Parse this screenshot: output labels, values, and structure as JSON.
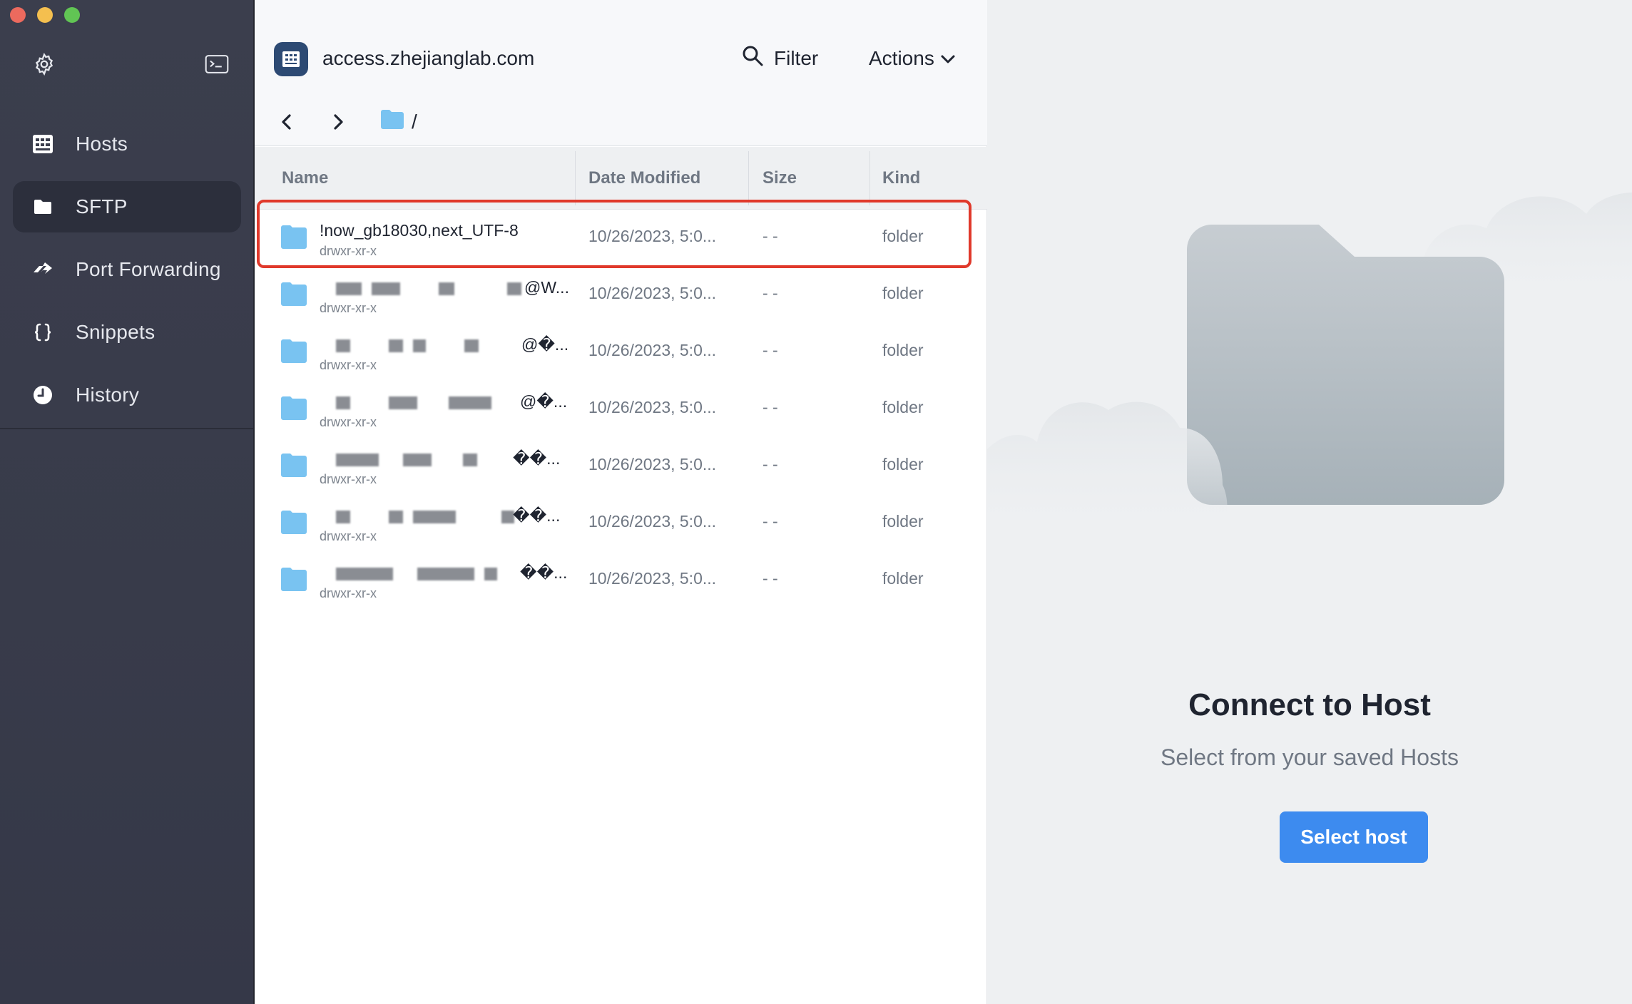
{
  "sidebar": {
    "items": [
      {
        "label": "Hosts",
        "icon": "hosts-icon"
      },
      {
        "label": "SFTP",
        "icon": "folder-icon",
        "active": true
      },
      {
        "label": "Port Forwarding",
        "icon": "port-forward-icon"
      },
      {
        "label": "Snippets",
        "icon": "braces-icon"
      },
      {
        "label": "History",
        "icon": "clock-icon"
      }
    ]
  },
  "header": {
    "host_name": "access.zhejianglab.com",
    "filter_label": "Filter",
    "actions_label": "Actions",
    "path": "/"
  },
  "table": {
    "columns": [
      "Name",
      "Date Modified",
      "Size",
      "Kind"
    ],
    "rows": [
      {
        "name": "!now_gb18030,next_UTF-8",
        "perm": "drwxr-xr-x",
        "date": "10/26/2023, 5:0...",
        "size": "- -",
        "kind": "folder"
      },
      {
        "name": "@W...",
        "perm": "drwxr-xr-x",
        "date": "10/26/2023, 5:0...",
        "size": "- -",
        "kind": "folder"
      },
      {
        "name": "@�...",
        "perm": "drwxr-xr-x",
        "date": "10/26/2023, 5:0...",
        "size": "- -",
        "kind": "folder"
      },
      {
        "name": "@�...",
        "perm": "drwxr-xr-x",
        "date": "10/26/2023, 5:0...",
        "size": "- -",
        "kind": "folder"
      },
      {
        "name": "��...",
        "perm": "drwxr-xr-x",
        "date": "10/26/2023, 5:0...",
        "size": "- -",
        "kind": "folder"
      },
      {
        "name": "��...",
        "perm": "drwxr-xr-x",
        "date": "10/26/2023, 5:0...",
        "size": "- -",
        "kind": "folder"
      },
      {
        "name": "��...",
        "perm": "drwxr-xr-x",
        "date": "10/26/2023, 5:0...",
        "size": "- -",
        "kind": "folder"
      }
    ]
  },
  "connect": {
    "title": "Connect to Host",
    "subtitle": "Select from your saved Hosts",
    "button_label": "Select host"
  },
  "colors": {
    "sidebar_bg": "#3b3e4d",
    "accent": "#3d8bef",
    "highlight": "#e0392b",
    "folder": "#79c3f1"
  }
}
